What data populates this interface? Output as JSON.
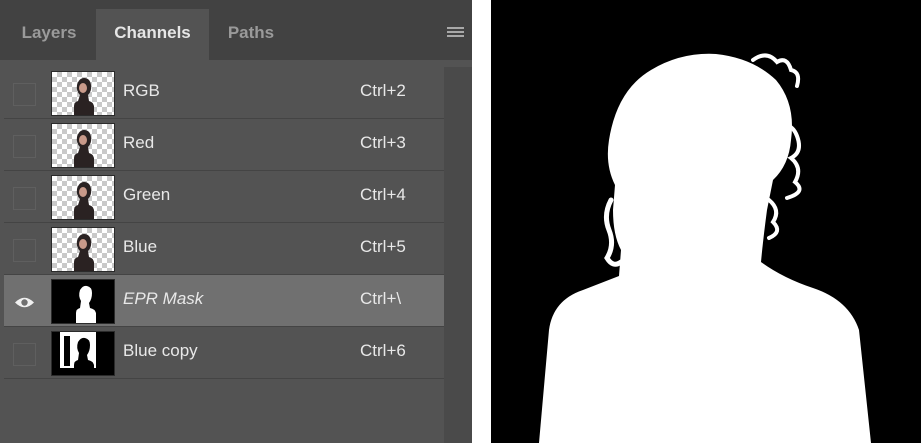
{
  "tabs": [
    {
      "label": "Layers",
      "active": false
    },
    {
      "label": "Channels",
      "active": true
    },
    {
      "label": "Paths",
      "active": false
    }
  ],
  "panel_menu_icon": "hamburger-icon",
  "channels": [
    {
      "name": "RGB",
      "shortcut": "Ctrl+2",
      "visible": false,
      "selected": false,
      "thumbnail": "portrait-transparent"
    },
    {
      "name": "Red",
      "shortcut": "Ctrl+3",
      "visible": false,
      "selected": false,
      "thumbnail": "portrait-transparent"
    },
    {
      "name": "Green",
      "shortcut": "Ctrl+4",
      "visible": false,
      "selected": false,
      "thumbnail": "portrait-transparent"
    },
    {
      "name": "Blue",
      "shortcut": "Ctrl+5",
      "visible": false,
      "selected": false,
      "thumbnail": "portrait-transparent"
    },
    {
      "name": "EPR Mask",
      "shortcut": "Ctrl+\\",
      "visible": true,
      "selected": true,
      "thumbnail": "silhouette-mask"
    },
    {
      "name": "Blue copy",
      "shortcut": "Ctrl+6",
      "visible": false,
      "selected": false,
      "thumbnail": "high-contrast-blue-copy"
    }
  ],
  "colors": {
    "panel_bg": "#535353",
    "tabbar_bg": "#424242",
    "selected_row": "#707070",
    "mask_bg": "#000000",
    "mask_fg": "#ffffff"
  }
}
